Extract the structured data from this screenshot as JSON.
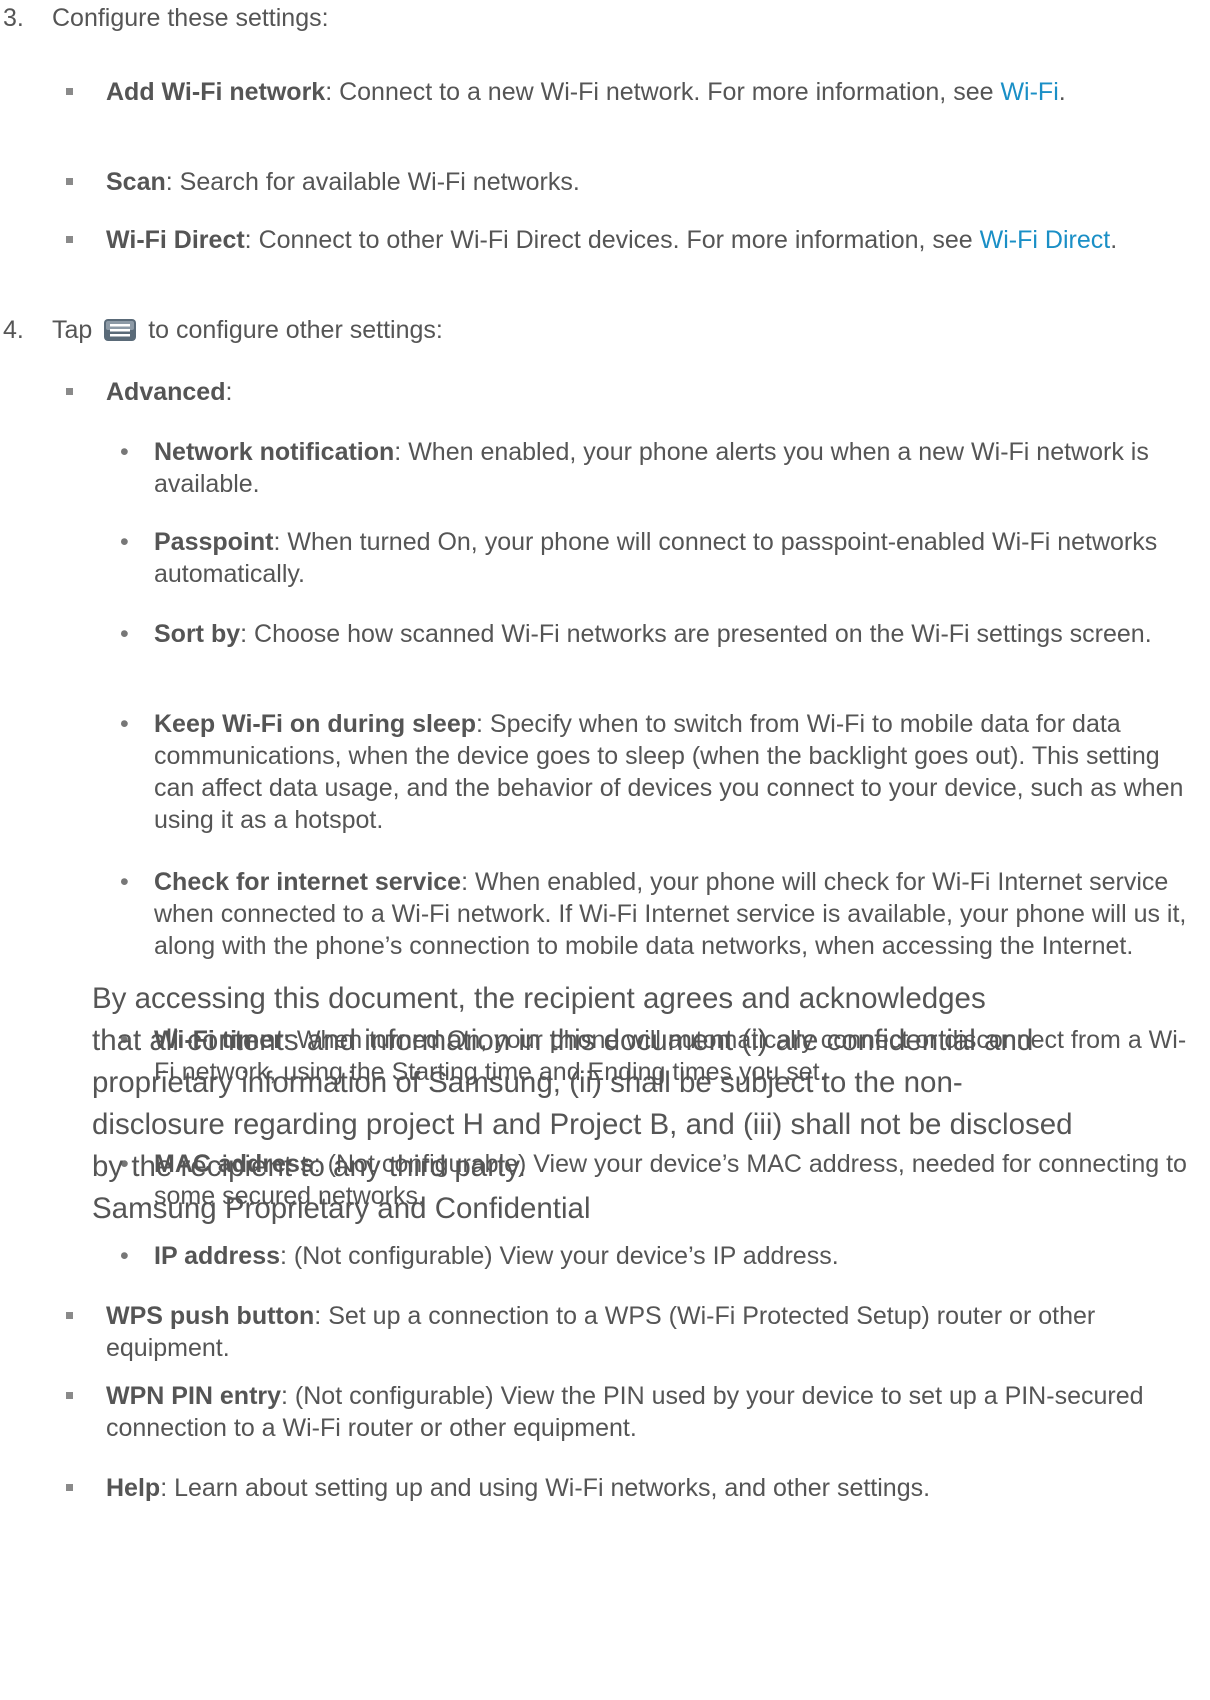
{
  "steps": [
    {
      "num": "3.",
      "text": "Configure these settings:"
    },
    {
      "num": "4.",
      "text_before_icon": "Tap",
      "icon": "menu-icon",
      "text_after_icon": "to configure other settings:"
    }
  ],
  "settings": {
    "add_wifi": {
      "term": "Add Wi-Fi network",
      "desc": ": Connect to a new Wi-Fi network. For more information, see ",
      "link": "Wi-Fi",
      "end": "."
    },
    "scan": {
      "term": "Scan",
      "desc": ": Search for available Wi-Fi networks."
    },
    "wifi_direct": {
      "term": "Wi-Fi Direct",
      "desc": ": Connect to other Wi-Fi Direct devices. For more information, see ",
      "link": "Wi-Fi Direct",
      "end": "."
    }
  },
  "advanced": {
    "term": "Advanced",
    "colon": ":",
    "items": [
      {
        "term": "Network notification",
        "desc": ": When enabled, your phone alerts you when a new Wi-Fi network is available."
      },
      {
        "term": "Passpoint",
        "desc": ": When turned On, your phone will connect to passpoint-enabled Wi-Fi networks automatically."
      },
      {
        "term": "Sort by",
        "desc": ": Choose how scanned Wi-Fi networks are presented on the Wi-Fi settings screen."
      },
      {
        "term": "Keep Wi-Fi on during sleep",
        "desc": ": Specify when to switch from Wi-Fi to mobile data for data communications, when the device goes to sleep (when the backlight goes out). This setting can affect data usage, and the behavior of devices you connect to your device, such as when using it as a hotspot."
      },
      {
        "term": "Check for internet service",
        "desc": ": When enabled, your phone will check for Wi-Fi Internet service when connected to a Wi-Fi network. If Wi-Fi Internet service is available, your phone will us it, along with the phone’s connection to mobile  data networks, when accessing the Internet."
      },
      {
        "term": "Wi-Fi timer",
        "desc": ": When turned On, your phone will automatically connect or disconnect from a Wi-Fi network, using the Starting time and Ending times you set."
      },
      {
        "term": "MAC address",
        "desc": ": (Not configurable) View your device’s MAC address, needed for connecting to some secured networks."
      },
      {
        "term": "IP address",
        "desc": ": (Not configurable) View your device’s IP address."
      }
    ]
  },
  "more_settings": [
    {
      "term": "WPS push button",
      "desc": ": Set up a connection to a WPS (Wi-Fi Protected Setup) router or other equipment."
    },
    {
      "term": "WPN PIN entry",
      "desc": ": (Not configurable) View the PIN used by your device to set up a PIN-secured connection to a Wi-Fi router or other equipment."
    },
    {
      "term": "Help",
      "desc": ": Learn about setting up and using Wi-Fi networks, and other settings."
    }
  ],
  "watermark": [
    "By accessing this document, the recipient agrees and acknowledges",
    "that all contents and information in this document (i) are confidential and",
    "proprietary information of Samsung, (ii) shall be subject to the non-",
    "disclosure regarding project H and Project B, and (iii) shall not be disclosed",
    "by the recipient to any third party.",
    "Samsung Proprietary and Confidential"
  ],
  "colors": {
    "text": "#555555",
    "link": "#1a8fc6",
    "bullet": "#8a8a8a"
  }
}
